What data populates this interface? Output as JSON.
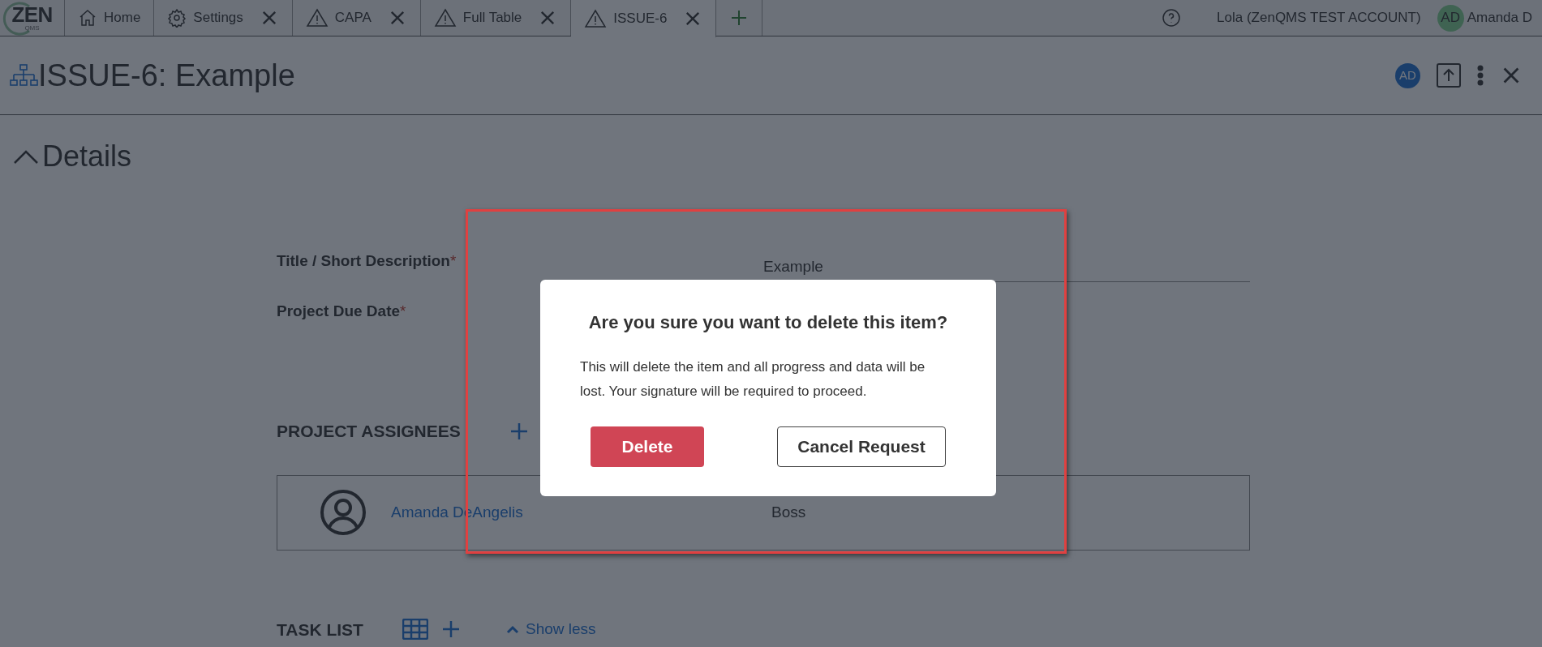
{
  "logo": {
    "main": "ZEN",
    "sub": "QMS"
  },
  "tabs": [
    {
      "label": "Home",
      "kind": "home",
      "closable": false,
      "selected": false
    },
    {
      "label": "Settings",
      "kind": "settings",
      "closable": true,
      "selected": false
    },
    {
      "label": "CAPA",
      "kind": "record",
      "closable": true,
      "selected": false
    },
    {
      "label": "Full Table",
      "kind": "record",
      "closable": true,
      "selected": false
    },
    {
      "label": "ISSUE-6",
      "kind": "record",
      "closable": true,
      "selected": true
    }
  ],
  "account": {
    "name": "Lola (ZenQMS TEST ACCOUNT)",
    "user_initials": "AD",
    "user_name": "Amanda D"
  },
  "record": {
    "title": "ISSUE-6: Example",
    "owner_initials": "AD"
  },
  "section": {
    "title": "Details",
    "expanded": true
  },
  "fields": [
    {
      "label": "Title / Short Description",
      "required_mark": "*",
      "value": "Example"
    },
    {
      "label": "Project Due Date",
      "required_mark": "*"
    }
  ],
  "assignees": {
    "heading": "PROJECT ASSIGNEES",
    "rows": [
      {
        "name": "Amanda DeAngelis",
        "role": "Boss"
      }
    ]
  },
  "task_list": {
    "heading": "TASK LIST",
    "toggle": "Show less"
  },
  "dialog": {
    "title": "Are you sure you want to delete this item?",
    "message": "This will delete the item and all progress and data will be lost. Your signature will be required to proceed.",
    "confirm": "Delete",
    "cancel": "Cancel Request"
  }
}
